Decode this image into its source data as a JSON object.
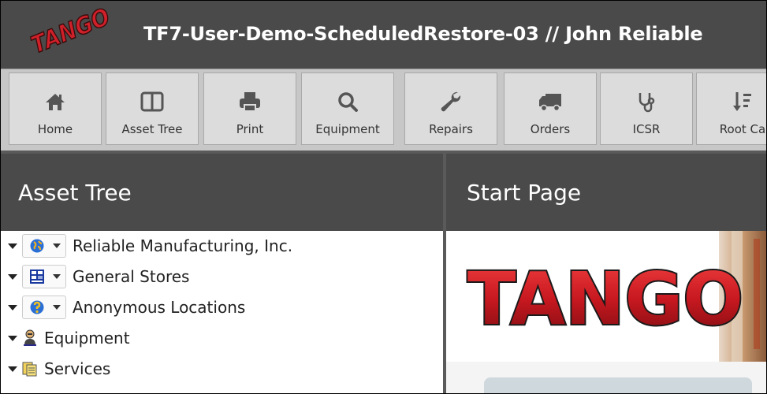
{
  "app": {
    "logo_text": "TANGO",
    "title": "TF7-User-Demo-ScheduledRestore-03  // John Reliable"
  },
  "toolbar": {
    "buttons": [
      {
        "label": "Home",
        "icon": "home-icon"
      },
      {
        "label": "Asset Tree",
        "icon": "columns-icon"
      },
      {
        "label": "Print",
        "icon": "print-icon"
      },
      {
        "label": "Equipment",
        "icon": "search-icon"
      },
      {
        "label": "Repairs",
        "icon": "wrench-icon"
      },
      {
        "label": "Orders",
        "icon": "truck-icon"
      },
      {
        "label": "ICSR",
        "icon": "stethoscope-icon"
      },
      {
        "label": "Root Ca",
        "icon": "sort-icon"
      }
    ]
  },
  "left_panel": {
    "title": "Asset Tree",
    "tree": [
      {
        "label": "Reliable Manufacturing, Inc.",
        "icon": "globe-icon",
        "has_dropdown": true
      },
      {
        "label": "General Stores",
        "icon": "store-grid-icon",
        "has_dropdown": true
      },
      {
        "label": "Anonymous Locations",
        "icon": "globe-question-icon",
        "has_dropdown": true
      },
      {
        "label": "Equipment",
        "icon": "person-icon",
        "has_dropdown": false
      },
      {
        "label": "Services",
        "icon": "documents-icon",
        "has_dropdown": false
      }
    ]
  },
  "right_panel": {
    "title": "Start Page",
    "banner_text": "TANGO"
  },
  "colors": {
    "header_bg": "#4a4a4a",
    "toolbar_bg": "#c7c7c7",
    "logo_red": "#d0202a"
  }
}
